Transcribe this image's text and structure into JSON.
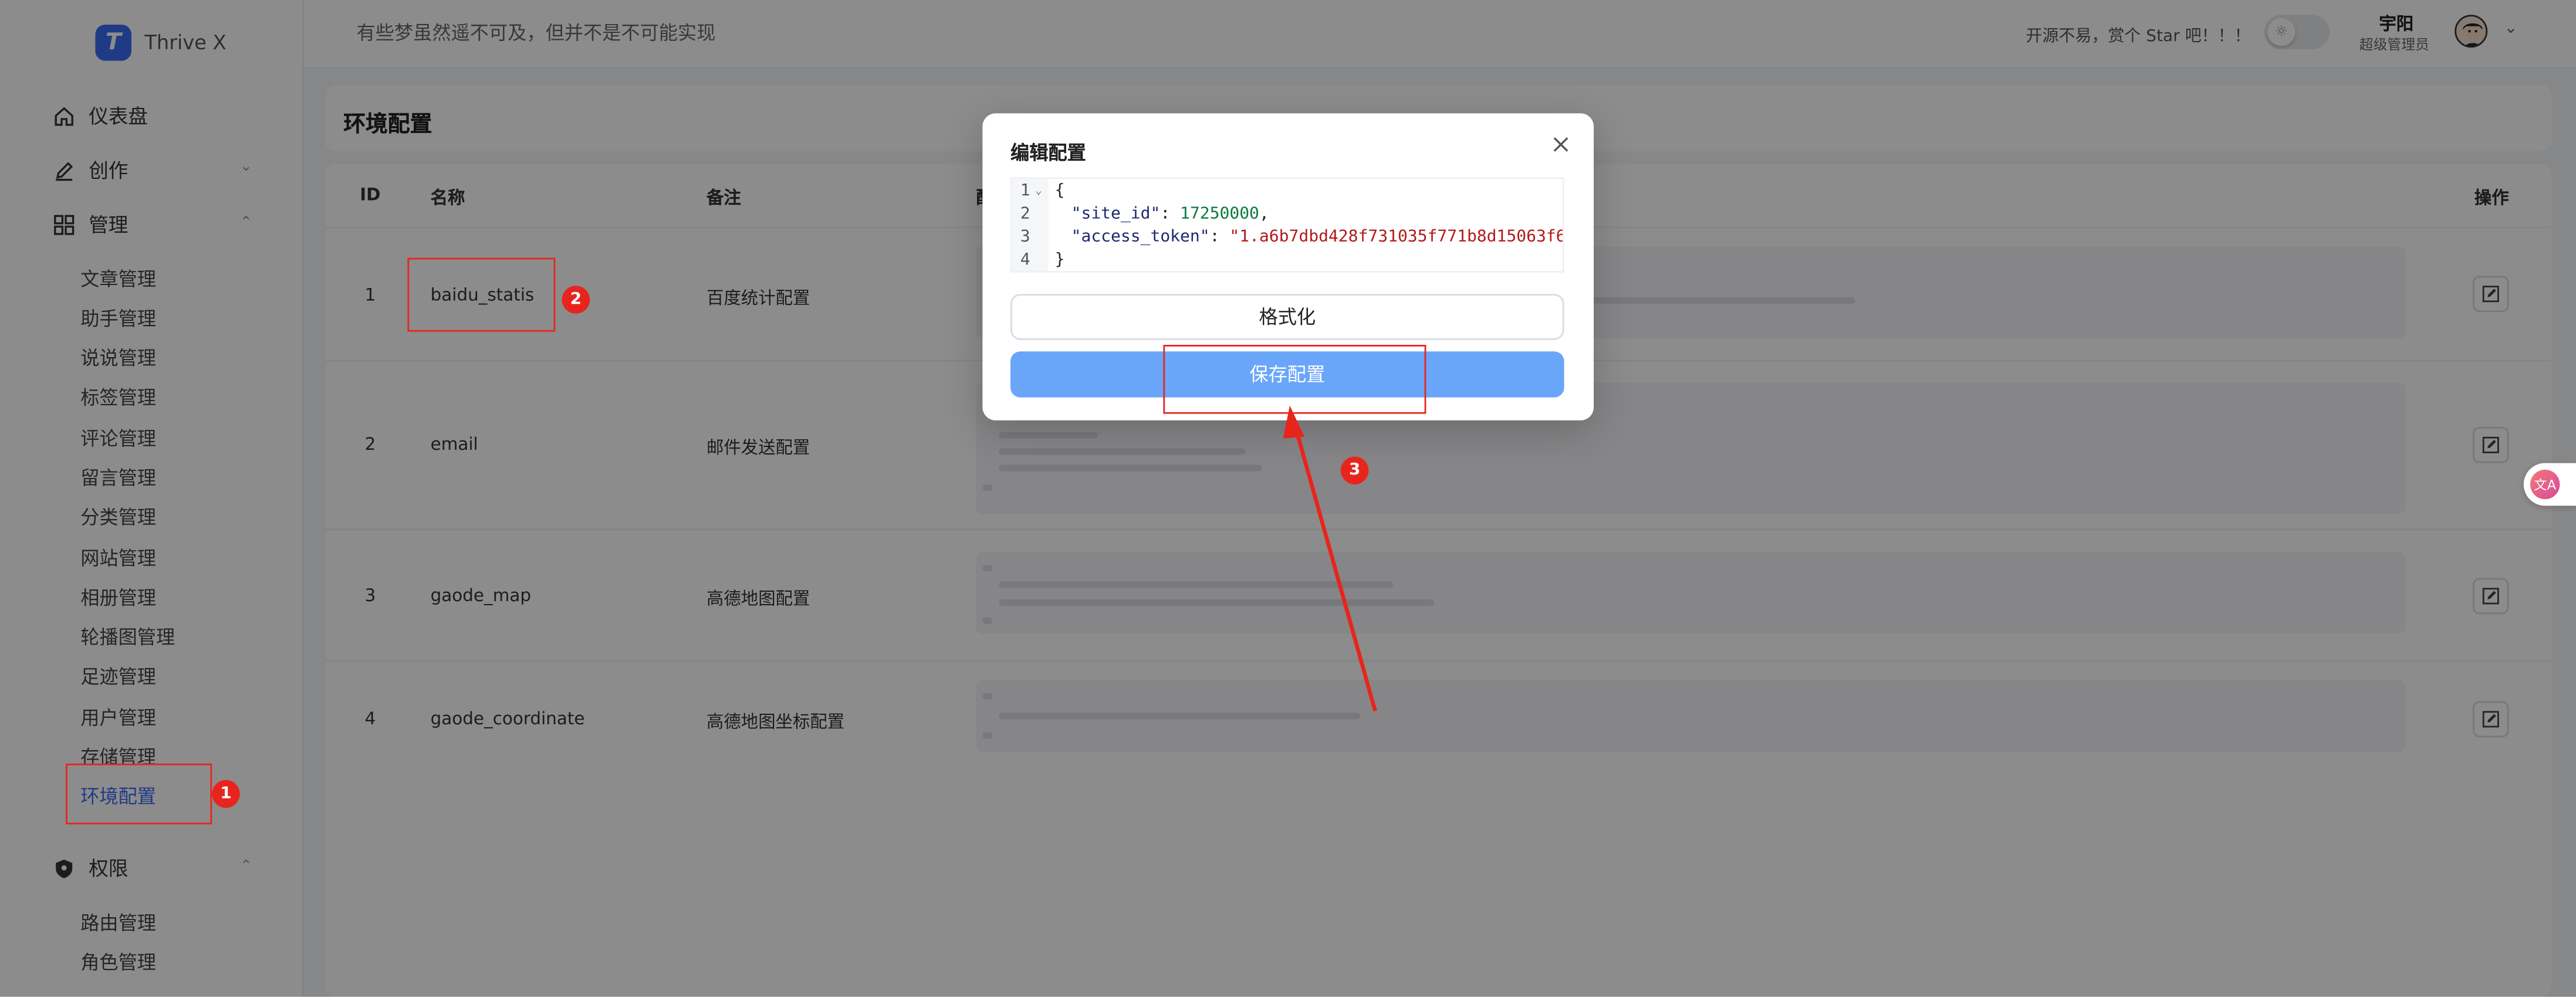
{
  "app": {
    "name": "Thrive X",
    "logo_letter": "T",
    "brand_color": "#3b6cf5"
  },
  "topbar": {
    "slogan": "有些梦虽然遥不可及，但并不是不可能实现",
    "star_text": "开源不易，赏个 Star 吧！！！",
    "user_name": "宇阳",
    "user_role": "超级管理员"
  },
  "sidebar": {
    "groups": {
      "dashboard": "仪表盘",
      "create": "创作",
      "manage": "管理",
      "permission": "权限"
    },
    "manage_items": [
      "文章管理",
      "助手管理",
      "说说管理",
      "标签管理",
      "评论管理",
      "留言管理",
      "分类管理",
      "网站管理",
      "相册管理",
      "轮播图管理",
      "足迹管理",
      "用户管理",
      "存储管理",
      "环境配置"
    ],
    "permission_items": [
      "路由管理",
      "角色管理"
    ],
    "active_item": "环境配置"
  },
  "page": {
    "title": "环境配置"
  },
  "table": {
    "headers": {
      "id": "ID",
      "name": "名称",
      "remark": "备注",
      "value": "配置",
      "action": "操作"
    },
    "rows": [
      {
        "id": "1",
        "name": "baidu_statis",
        "remark": "百度统计配置"
      },
      {
        "id": "2",
        "name": "email",
        "remark": "邮件发送配置"
      },
      {
        "id": "3",
        "name": "gaode_map",
        "remark": "高德地图配置"
      },
      {
        "id": "4",
        "name": "gaode_coordinate",
        "remark": "高德地图坐标配置"
      }
    ]
  },
  "modal": {
    "title": "编辑配置",
    "code": {
      "open": "{",
      "key1": "\"site_id\"",
      "val1": "17250000",
      "key2": "\"access_token\"",
      "val2": "\"1.a6b7dbd428f731035f771b8d15063f6",
      "close": "}"
    },
    "line_numbers": [
      "1",
      "2",
      "3",
      "4"
    ],
    "format_label": "格式化",
    "save_label": "保存配置",
    "save_color": "#69a6f9"
  },
  "annotations": {
    "badges": [
      "1",
      "2",
      "3"
    ],
    "color": "#e8251d"
  }
}
